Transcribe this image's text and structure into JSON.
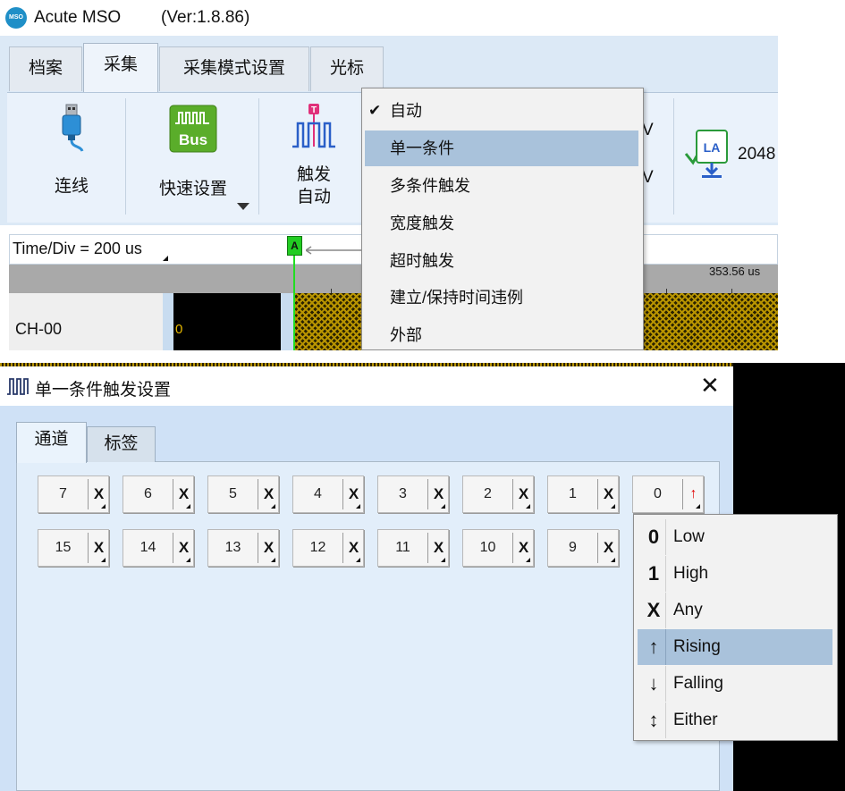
{
  "app": {
    "logo_text": "Acute MSO",
    "title": "Acute MSO",
    "version": "(Ver:1.8.86)",
    "tabs": [
      {
        "label": "档案"
      },
      {
        "label": "采集",
        "active": true
      },
      {
        "label": "采集模式设置"
      },
      {
        "label": "光标"
      }
    ],
    "ribbon": {
      "connect_label": "连线",
      "quick_setup_label": "快速设置",
      "trigger_label_1": "触发",
      "trigger_label_2": "自动",
      "voltage_1": "V",
      "voltage_2": "V",
      "la_value": "2048"
    },
    "time_div": "Time/Div = 200 us",
    "ruler_label": "353.56 us",
    "cursor_label": "A",
    "channel": {
      "name": "CH-00",
      "value": "0"
    },
    "trigger_menu": {
      "checked_index": 0,
      "highlight_index": 1,
      "items": [
        "自动",
        "单一条件",
        "多条件触发",
        "宽度触发",
        "超时触发",
        "建立/保持时间违例",
        "外部"
      ]
    }
  },
  "dialog": {
    "title": "单一条件触发设置",
    "tabs": [
      {
        "label": "通道",
        "active": true
      },
      {
        "label": "标签"
      }
    ],
    "channels_row1": [
      {
        "num": "7",
        "state": "X"
      },
      {
        "num": "6",
        "state": "X"
      },
      {
        "num": "5",
        "state": "X"
      },
      {
        "num": "4",
        "state": "X"
      },
      {
        "num": "3",
        "state": "X"
      },
      {
        "num": "2",
        "state": "X"
      },
      {
        "num": "1",
        "state": "X"
      },
      {
        "num": "0",
        "state": "↑"
      }
    ],
    "channels_row2": [
      {
        "num": "15",
        "state": "X"
      },
      {
        "num": "14",
        "state": "X"
      },
      {
        "num": "13",
        "state": "X"
      },
      {
        "num": "12",
        "state": "X"
      },
      {
        "num": "11",
        "state": "X"
      },
      {
        "num": "10",
        "state": "X"
      },
      {
        "num": "9",
        "state": "X"
      }
    ],
    "state_menu": {
      "highlight_index": 3,
      "items": [
        {
          "symbol": "0",
          "label": "Low"
        },
        {
          "symbol": "1",
          "label": "High"
        },
        {
          "symbol": "X",
          "label": "Any"
        },
        {
          "symbol": "↑",
          "label": "Rising"
        },
        {
          "symbol": "↓",
          "label": "Falling"
        },
        {
          "symbol": "↕",
          "label": "Either"
        }
      ]
    }
  },
  "colors": {
    "ribbon_bg": "#dce9f6",
    "highlight": "#a9c2db",
    "cursor_green": "#22cc22",
    "rising_red": "#e00000"
  }
}
